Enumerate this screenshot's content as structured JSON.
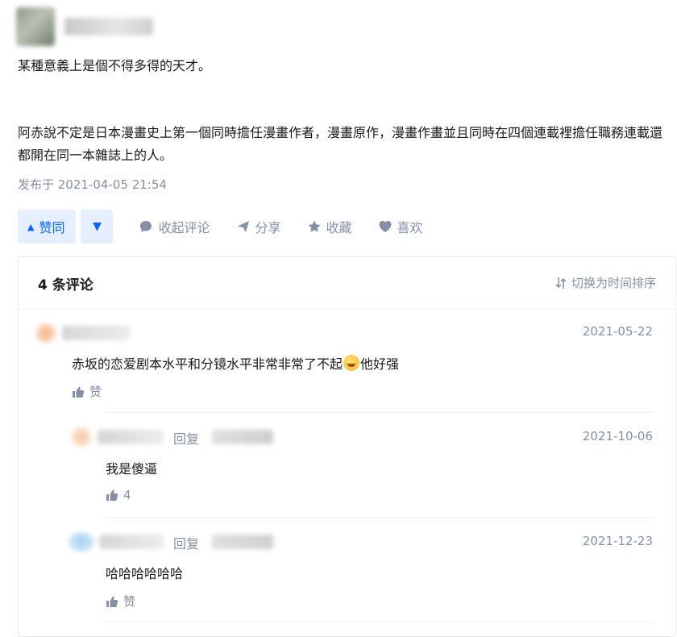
{
  "post": {
    "paragraphs": [
      "某種意義上是個不得多得的天才。",
      "阿赤說不定是日本漫畫史上第一個同時擔任漫畫作者，漫畫原作，漫畫作畫並且同時在四個連載裡擔任職務連載還都開在同一本雜誌上的人。"
    ],
    "published": "发布于 2021-04-05 21:54"
  },
  "actions": {
    "vote_label": "赞同",
    "collapse_comments": "收起评论",
    "share": "分享",
    "favorite": "收藏",
    "like": "喜欢"
  },
  "comments": {
    "count_label": "4 条评论",
    "sort_label": "切换为时间排序",
    "items": [
      {
        "date": "2021-05-22",
        "text_before": "赤坂的恋爱剧本水平和分镜水平非常非常了不起",
        "text_after": "他好强",
        "like_label": "赞"
      },
      {
        "reply_label": "回复",
        "date": "2021-10-06",
        "text": "我是傻逼",
        "like_label": "4"
      },
      {
        "reply_label": "回复",
        "date": "2021-12-23",
        "text": "哈哈哈哈哈哈",
        "like_label": "赞"
      }
    ]
  },
  "colors": {
    "accent": "#0066ff",
    "accent_bg": "#e6efff",
    "meta_gray": "#8590a6"
  },
  "icons": [
    "triangle-up-icon",
    "triangle-down-icon",
    "comment-icon",
    "share-icon",
    "star-icon",
    "heart-icon",
    "sort-icon",
    "thumb-up-icon",
    "laughing-emoji-icon"
  ]
}
